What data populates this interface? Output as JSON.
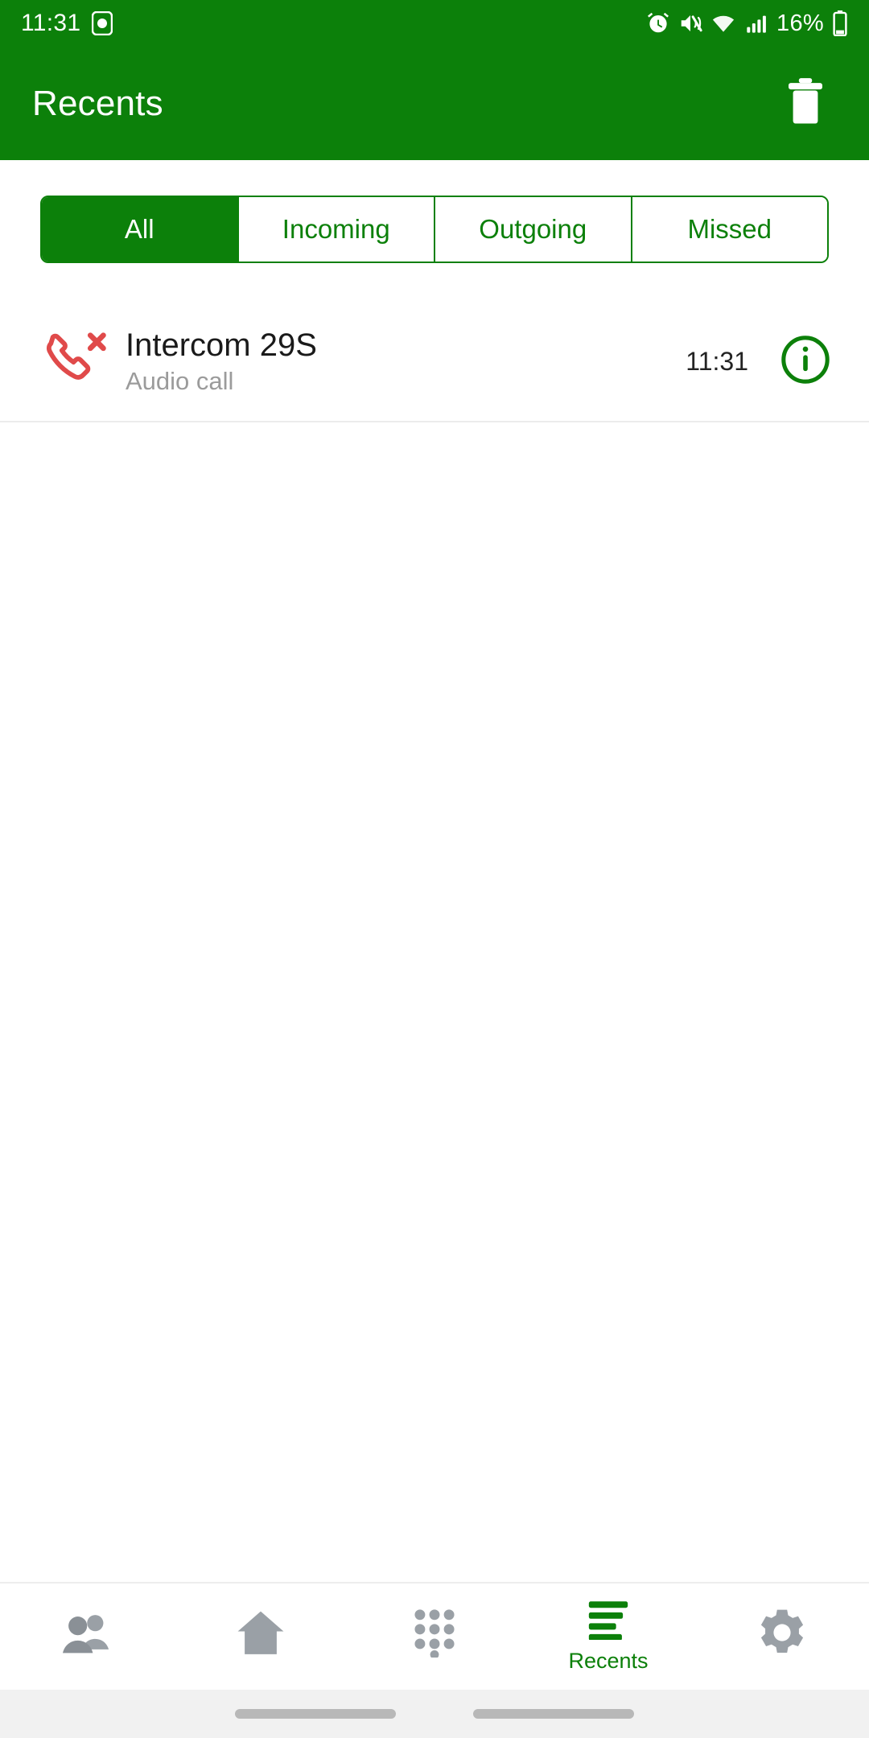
{
  "theme": {
    "brand_green": "#0C800A",
    "missed_red": "#E04A4A",
    "inactive_gray": "#9AA0A6"
  },
  "status_bar": {
    "time": "11:31",
    "battery_percent": "16%",
    "icons": [
      "notification-badge-icon",
      "alarm-icon",
      "mute-icon",
      "wifi-icon",
      "cellular-signal-icon",
      "battery-icon"
    ]
  },
  "app_bar": {
    "title": "Recents",
    "delete_icon": "trash-icon"
  },
  "filters": {
    "tabs": [
      {
        "label": "All",
        "active": true
      },
      {
        "label": "Incoming",
        "active": false
      },
      {
        "label": "Outgoing",
        "active": false
      },
      {
        "label": "Missed",
        "active": false
      }
    ]
  },
  "call_log": {
    "entries": [
      {
        "name": "Intercom 29S",
        "type": "Audio call",
        "time": "11:31",
        "status_icon": "missed-call-icon",
        "info_icon": "info-icon"
      }
    ]
  },
  "bottom_nav": {
    "items": [
      {
        "label": "",
        "icon": "contacts-icon",
        "active": false
      },
      {
        "label": "",
        "icon": "home-icon",
        "active": false
      },
      {
        "label": "",
        "icon": "dialpad-icon",
        "active": false
      },
      {
        "label": "Recents",
        "icon": "recents-icon",
        "active": true
      },
      {
        "label": "",
        "icon": "settings-gear-icon",
        "active": false
      }
    ]
  }
}
